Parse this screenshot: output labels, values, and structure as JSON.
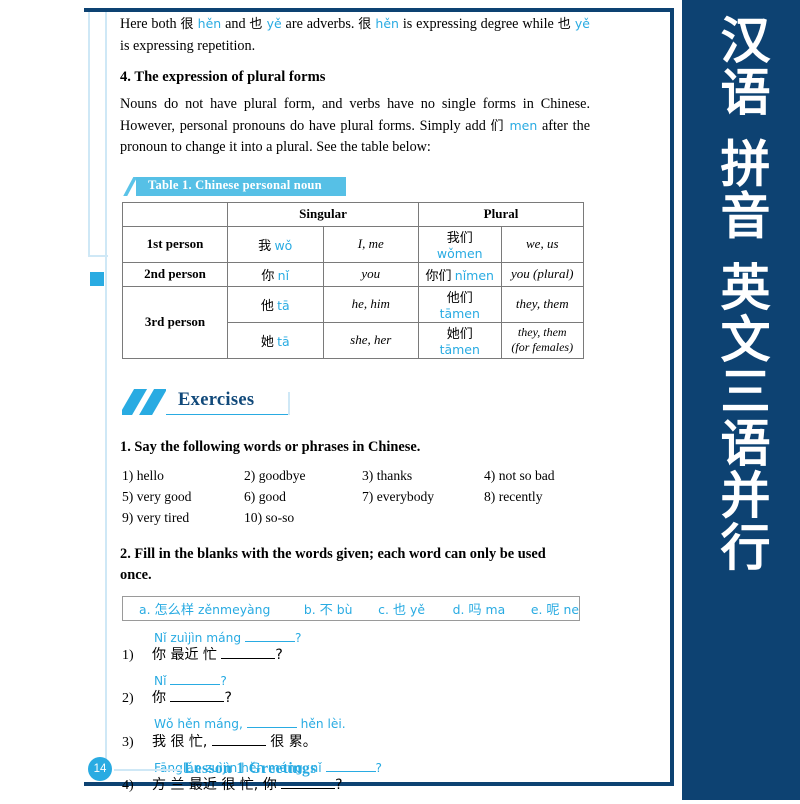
{
  "side_tab": {
    "vertical_text": "汉语 拼音 英文三语并行",
    "bg_color": "#0d4272"
  },
  "colors": {
    "navy": "#0d4272",
    "accent_blue": "#29abe2",
    "caption_blue": "#56c0e6",
    "light_rule": "#cfe8f6"
  },
  "intro": {
    "para1_a": "Here both ",
    "para1_hz1": "很",
    "para1_py1": "hěn",
    "para1_b": " and ",
    "para1_hz2": "也",
    "para1_py2": "yě",
    "para1_c": " are adverbs. ",
    "para1_hz3": "很",
    "para1_py3": "hěn",
    "para1_d": " is expressing degree while ",
    "para1_hz4": "也",
    "para1_py4": "yě",
    "para1_e": " is expressing repetition."
  },
  "section4": {
    "heading": "4. The expression of plural forms",
    "body_a": "Nouns do not have plural form, and verbs have no single forms in Chinese. However, personal pronouns do have plural forms. Simply add ",
    "body_hz": "们",
    "body_py": "men",
    "body_b": " after the pronoun to change it into a plural. See the table below:"
  },
  "table": {
    "caption": "Table 1. Chinese personal noun",
    "headers": [
      "",
      "Singular",
      "Plural"
    ],
    "rows": [
      {
        "person": "1st person",
        "sing_hz": "我",
        "sing_py": "wǒ",
        "sing_en": "I, me",
        "plur_hz": "我们",
        "plur_py": "wǒmen",
        "plur_en": "we, us"
      },
      {
        "person": "2nd person",
        "sing_hz": "你",
        "sing_py": "nǐ",
        "sing_en": "you",
        "plur_hz": "你们",
        "plur_py": "nǐmen",
        "plur_en": "you (plural)"
      },
      {
        "person": "3rd person",
        "sing_hz": "他",
        "sing_py": "tā",
        "sing_en": "he, him",
        "plur_hz": "他们",
        "plur_py": "tāmen",
        "plur_en": "they, them"
      },
      {
        "person": "",
        "sing_hz": "她",
        "sing_py": "tā",
        "sing_en": "she, her",
        "plur_hz": "她们",
        "plur_py": "tāmen",
        "plur_en": "they, them (for females)"
      }
    ]
  },
  "exercises": {
    "title": "Exercises",
    "q1": {
      "prompt": "1. Say the following words or phrases in Chinese.",
      "items": [
        "1) hello",
        "2) goodbye",
        "3) thanks",
        "4) not so bad",
        "5) very good",
        "6) good",
        "7) everybody",
        "8) recently",
        "9) very tired",
        "10) so-so"
      ]
    },
    "q2": {
      "prompt": "2. Fill in the blanks with the words given; each word can only be used once.",
      "word_bank": [
        {
          "label": "a.",
          "hz": "怎么样",
          "py": "zěnmeyàng"
        },
        {
          "label": "b.",
          "hz": "不",
          "py": "bù"
        },
        {
          "label": "c.",
          "hz": "也",
          "py": "yě"
        },
        {
          "label": "d.",
          "hz": "吗",
          "py": "ma"
        },
        {
          "label": "e.",
          "hz": "呢",
          "py": "ne"
        }
      ],
      "items": [
        {
          "num": "1)",
          "py_a": "Nǐ zuìjìn máng ",
          "py_b": "?",
          "hz_a": "你 最近  忙 ",
          "hz_b": "?"
        },
        {
          "num": "2)",
          "py_a": "Nǐ ",
          "py_b": "?",
          "hz_a": "你 ",
          "hz_b": "?"
        },
        {
          "num": "3)",
          "py_a": "Wǒ hěn máng, ",
          "py_b": " hěn lèi.",
          "hz_a": "我 很  忙, ",
          "hz_b": " 很 累。"
        },
        {
          "num": "4)",
          "py_a": "Fānglán zuìjìn hěn máng, nǐ ",
          "py_b": "?",
          "hz_a": "方 兰 最近 很  忙, 你 ",
          "hz_b": "?"
        }
      ]
    }
  },
  "footer": {
    "page_number": "14",
    "lesson_title": "Lesson 1  Greetings"
  }
}
